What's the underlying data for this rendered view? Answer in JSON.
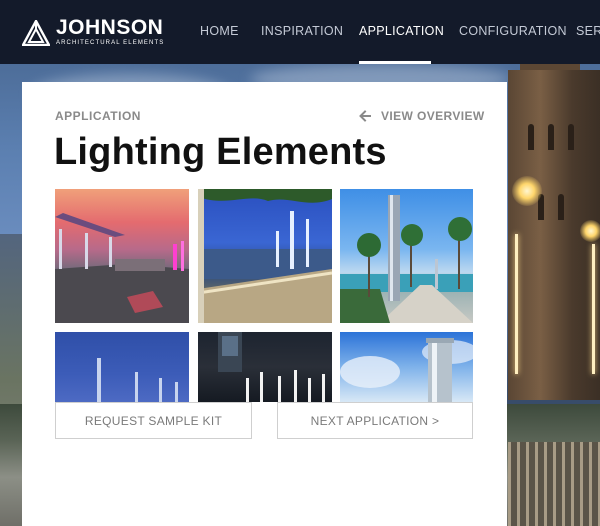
{
  "header": {
    "logo": {
      "name": "JOHNSON",
      "tagline": "ARCHITECTURAL ELEMENTS"
    },
    "nav": [
      {
        "label": "HOME",
        "active": false
      },
      {
        "label": "INSPIRATION",
        "active": false
      },
      {
        "label": "APPLICATION",
        "active": true
      },
      {
        "label": "CONFIGURATION",
        "active": false
      },
      {
        "label": "SERV",
        "active": false
      }
    ]
  },
  "panel": {
    "eyebrow": "APPLICATION",
    "view_overview": "VIEW OVERVIEW",
    "title": "Lighting Elements",
    "request_sample": "REQUEST SAMPLE KIT",
    "next_application": "NEXT APPLICATION >"
  },
  "icons": {
    "logo": "triangle-logo-icon",
    "back": "arrow-left-icon"
  },
  "colors": {
    "header_bg": "#131a2a",
    "nav_active": "#ffffff",
    "nav_inactive": "#c4cad6",
    "label_gray": "#8a8a8a",
    "title": "#111111"
  }
}
